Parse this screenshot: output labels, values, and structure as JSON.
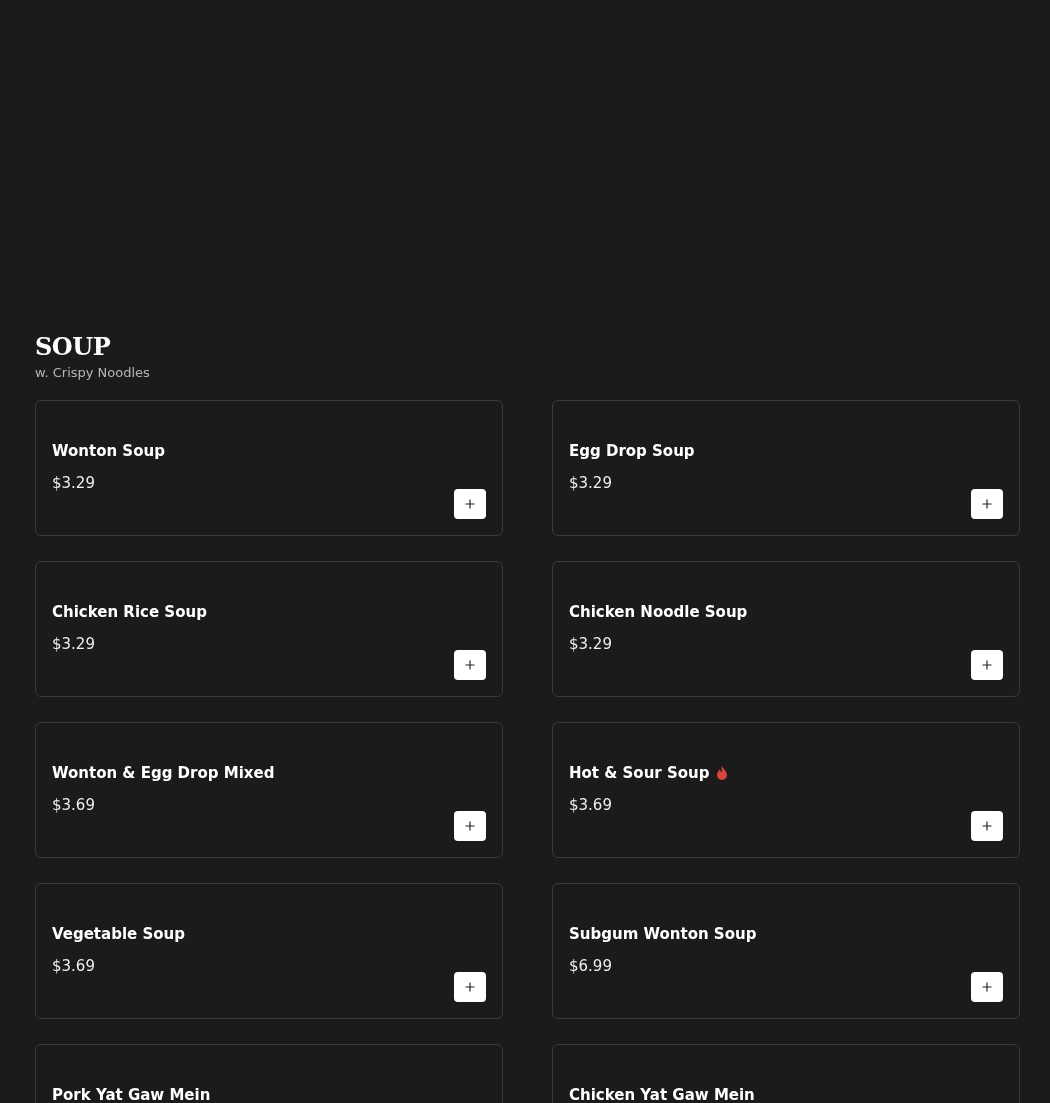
{
  "section": {
    "title": "SOUP",
    "subtitle": "w. Crispy Noodles"
  },
  "items": [
    {
      "name": "Wonton Soup",
      "price": "$3.29",
      "spicy": false
    },
    {
      "name": "Egg Drop Soup",
      "price": "$3.29",
      "spicy": false
    },
    {
      "name": "Chicken Rice Soup",
      "price": "$3.29",
      "spicy": false
    },
    {
      "name": "Chicken Noodle Soup",
      "price": "$3.29",
      "spicy": false
    },
    {
      "name": "Wonton & Egg Drop Mixed",
      "price": "$3.69",
      "spicy": false
    },
    {
      "name": "Hot & Sour Soup",
      "price": "$3.69",
      "spicy": true
    },
    {
      "name": "Vegetable Soup",
      "price": "$3.69",
      "spicy": false
    },
    {
      "name": "Subgum Wonton Soup",
      "price": "$6.99",
      "spicy": false
    },
    {
      "name": "Pork Yat Gaw Mein",
      "spicy": false
    },
    {
      "name": "Chicken Yat Gaw Mein",
      "spicy": false
    }
  ]
}
